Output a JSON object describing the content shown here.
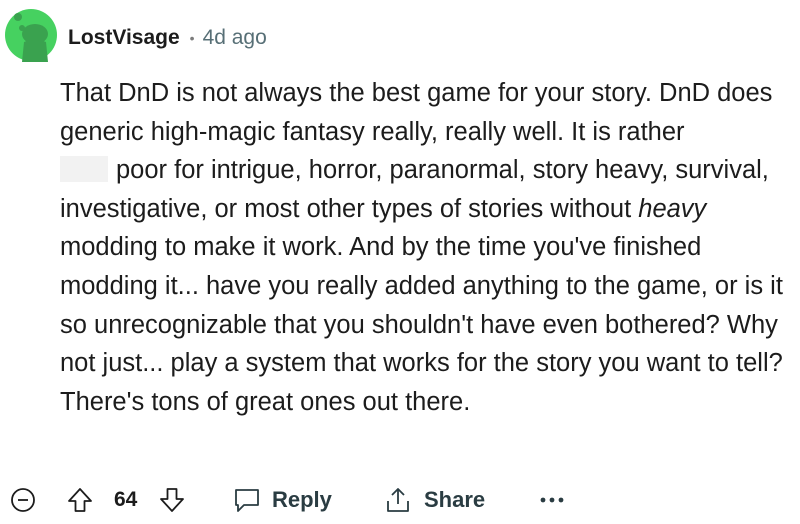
{
  "comment": {
    "author": "LostVisage",
    "separator": "•",
    "timestamp": "4d ago",
    "body": {
      "part1": "That DnD is not always the best game for your story. DnD does generic high-magic fantasy really, really well. It is rather ",
      "part2": "poor for intrigue, horror, paranormal, story heavy, survival, investigative, or most other types of stories without ",
      "emphasis": "heavy",
      "part3": " modding to make it work. And by the time you've finished modding it... have you really added anything to the game, or is it so unrecognizable that you shouldn't have even bothered? Why not just... play a system that works for the story you want to tell? There's tons of great ones out there."
    }
  },
  "actions": {
    "collapse_icon": "collapse-minus-icon",
    "upvote_icon": "upvote-arrow-icon",
    "vote_count": "64",
    "downvote_icon": "downvote-arrow-icon",
    "reply_label": "Reply",
    "reply_icon": "speech-bubble-icon",
    "share_label": "Share",
    "share_icon": "share-upload-icon",
    "more_icon": "more-options-icon",
    "more_label": "•••"
  },
  "colors": {
    "avatar_green": "#46d160",
    "text": "#1c1c1c",
    "muted": "#576f76",
    "action_text": "#2a3c42"
  }
}
